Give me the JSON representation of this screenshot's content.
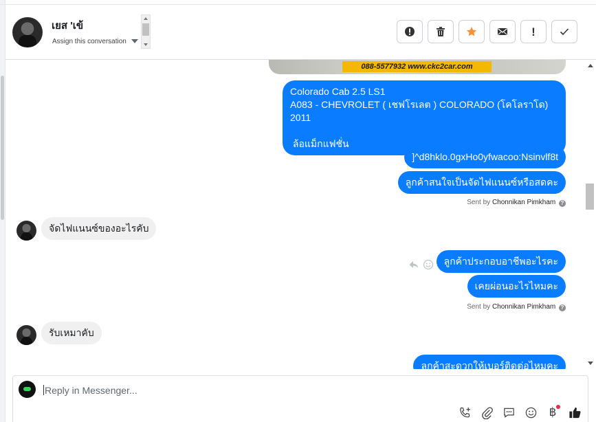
{
  "header": {
    "contact_name": "เยส 'เข้",
    "assign_label": "Assign this conversation",
    "actions": [
      {
        "name": "spam-button",
        "icon": "alert-circle-icon"
      },
      {
        "name": "delete-button",
        "icon": "trash-icon"
      },
      {
        "name": "star-button",
        "icon": "star-icon",
        "color": "#f7923b"
      },
      {
        "name": "mark-unread-button",
        "icon": "envelope-icon"
      },
      {
        "name": "follow-up-button",
        "icon": "exclamation-icon",
        "label": "!"
      },
      {
        "name": "done-button",
        "icon": "checkmark-icon"
      }
    ]
  },
  "thread": {
    "image_banner_text": "088-5577932 www.ckc2car.com",
    "messages": [
      {
        "direction": "out",
        "lines": [
          "Colorado Cab 2.5 LS1",
          "A083 - CHEVROLET ( เชฟโรเลต ) COLORADO (โคโลราโด) 2011",
          "",
          " ล้อแม็กแฟชั่น"
        ]
      },
      {
        "direction": "out",
        "text": "]^d8hklo.0gxHo0yfwacoo:Nsinvlf8t"
      },
      {
        "direction": "out",
        "text": "ลูกค้าสนใจเป็นจัดไฟแนนซ์หรือสดคะ"
      },
      {
        "direction": "in",
        "text": "จัดไฟแนนซ์ของอะไรคับ"
      },
      {
        "direction": "out",
        "text": "ลูกค้าประกอบอาชีพอะไรคะ"
      },
      {
        "direction": "out",
        "text": "เคยผ่อนอะไรไหมคะ"
      },
      {
        "direction": "in",
        "text": "รับเหมาคับ"
      },
      {
        "direction": "out",
        "text": "ลูกค้าสะดวกให้เบอร์ติดต่อไหมคะ"
      }
    ],
    "sent_by_prefix": "Sent by",
    "sent_by_name": "Chonnikan Pimkham",
    "sent_by_help": "?"
  },
  "composer": {
    "placeholder": "Reply in Messenger...",
    "tools": [
      "phone-add-icon",
      "paperclip-icon",
      "chat-bubble-icon",
      "emoji-icon",
      "baht-icon",
      "thumbs-up-icon"
    ],
    "baht_symbol": "฿"
  },
  "colors": {
    "outgoing_bubble": "#0a7cff",
    "incoming_bubble": "#f0f0f0",
    "banner": "#f5b800"
  }
}
